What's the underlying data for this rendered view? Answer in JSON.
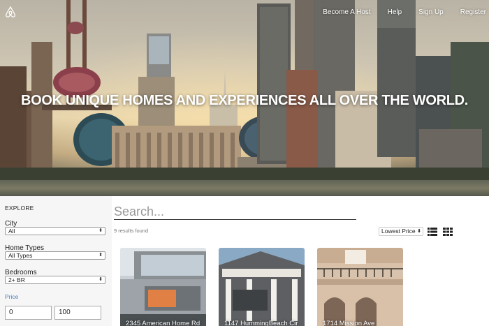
{
  "nav": {
    "logo_icon": "airbnb-logo-icon",
    "links": [
      "Become A Host",
      "Help",
      "Sign Up",
      "Register"
    ]
  },
  "hero": {
    "title": "BOOK UNIQUE HOMES AND EXPERIENCES ALL OVER THE WORLD."
  },
  "sidebar": {
    "heading": "EXPLORE",
    "city_label": "City",
    "city_value": "All",
    "home_types_label": "Home Types",
    "home_types_value": "All Types",
    "bedrooms_label": "Bedrooms",
    "bedrooms_value": "2+ BR",
    "price_label": "Price",
    "price_min": "0",
    "price_max": "100"
  },
  "main": {
    "search_placeholder": "Search...",
    "results_text": "9 results found",
    "sort_value": "Lowest Price",
    "list_view_icon": "list-view-icon",
    "grid_view_icon": "grid-view-icon",
    "listings": [
      {
        "address": "2345 American Home Rd"
      },
      {
        "address": "1147 HummingBeach Cir"
      },
      {
        "address": "1714 Mission Ave"
      }
    ]
  },
  "colors": {
    "accent_blue": "#4a7fb5",
    "sidebar_bg": "#f6f6f6"
  }
}
